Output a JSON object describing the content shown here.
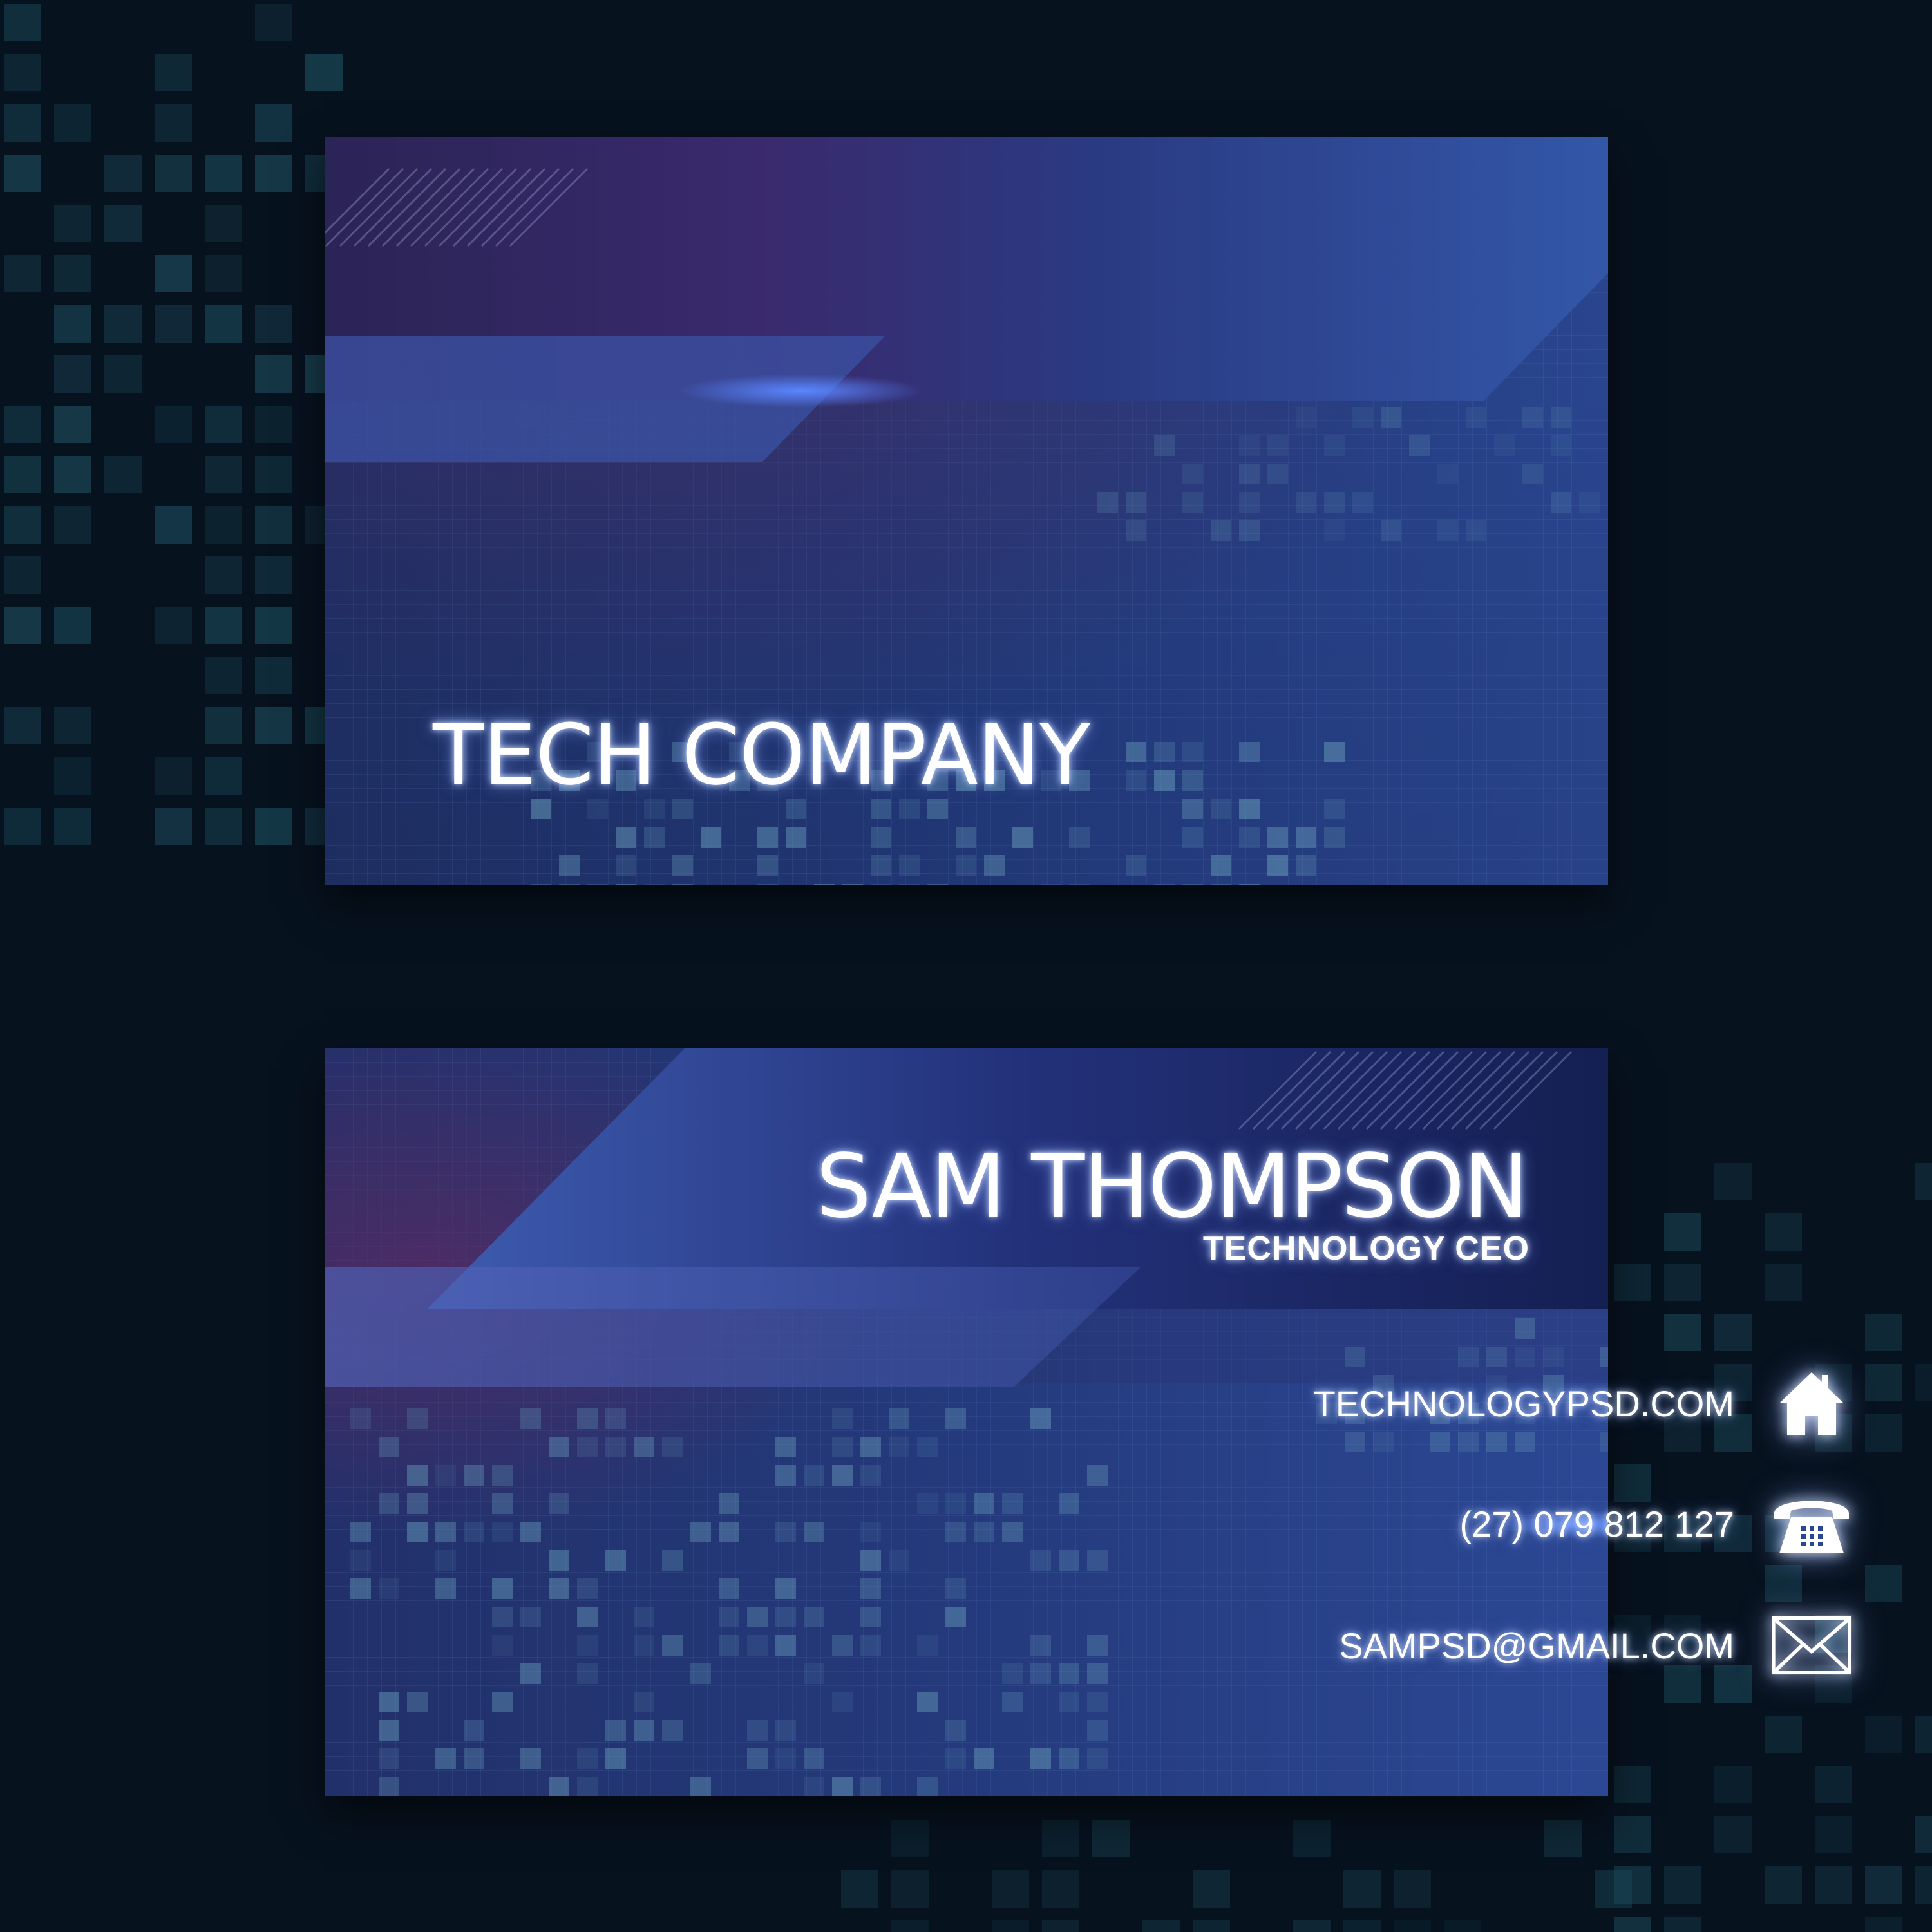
{
  "front": {
    "company_name": "TECH COMPANY"
  },
  "back": {
    "name": "SAM THOMPSON",
    "title": "TECHNOLOGY CEO",
    "contacts": [
      {
        "type": "website",
        "text": "TECHNOLOGYPSD.COM",
        "icon": "house-icon"
      },
      {
        "type": "phone",
        "text": "(27) 079 812 127",
        "icon": "telephone-icon"
      },
      {
        "type": "email",
        "text": "SAMPSD@GMAIL.COM",
        "icon": "envelope-icon"
      }
    ]
  },
  "colors": {
    "background": "#07121f",
    "card_blue": "#2a4690",
    "accent_purple": "#3d2a6e",
    "glow": "#4f7bff",
    "text": "#ffffff"
  }
}
